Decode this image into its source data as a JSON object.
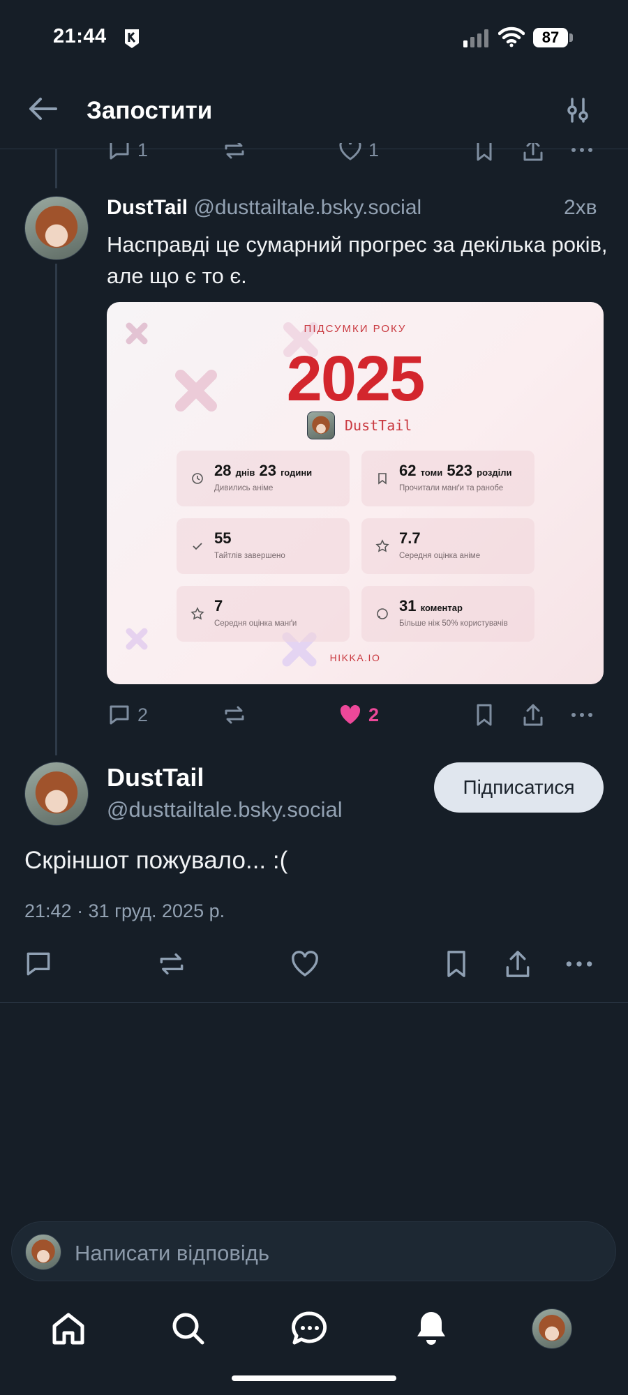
{
  "status_bar": {
    "time": "21:44",
    "battery": "87"
  },
  "header": {
    "title": "Запостити"
  },
  "parent_actions": {
    "replies": "1",
    "likes": "1"
  },
  "reply_post": {
    "display_name": "DustTail",
    "handle": "@dusttailtale.bsky.social",
    "time_ago": "2хв",
    "text": "Насправді це сумарний прогрес за декілька років, але що є то є.",
    "embed": {
      "kicker": "ПІДСУМКИ РОКУ",
      "year": "2025",
      "user": "DustTail",
      "stats": [
        {
          "icon": "history-icon",
          "value_main": "28",
          "unit_1": "днів",
          "value_2": "23",
          "unit_2": "години",
          "label": "Дивились аніме"
        },
        {
          "icon": "book-icon",
          "value_main": "62",
          "unit_1": "томи",
          "value_2": "523",
          "unit_2": "розділи",
          "label": "Прочитали манґи та ранобе"
        },
        {
          "icon": "check-icon",
          "value_main": "55",
          "unit_1": "",
          "value_2": "",
          "unit_2": "",
          "label": "Тайтлів завершено"
        },
        {
          "icon": "star-icon",
          "value_main": "7.7",
          "unit_1": "",
          "value_2": "",
          "unit_2": "",
          "label": "Середня оцінка аніме"
        },
        {
          "icon": "star-icon",
          "value_main": "7",
          "unit_1": "",
          "value_2": "",
          "unit_2": "",
          "label": "Середня оцінка манґи"
        },
        {
          "icon": "comment-icon",
          "value_main": "31",
          "unit_1": "коментар",
          "value_2": "",
          "unit_2": "",
          "label": "Більше ніж 50% користувачів"
        }
      ],
      "footer": "HIKKA.IO"
    },
    "replies": "2",
    "likes": "2",
    "like_color": "#ec4899"
  },
  "main_post": {
    "display_name": "DustTail",
    "handle": "@dusttailtale.bsky.social",
    "follow_label": "Підписатися",
    "text": "Скріншот пожувало... :(",
    "datetime": "21:42 · 31 груд. 2025 р."
  },
  "reply_bar": {
    "placeholder": "Написати відповідь"
  },
  "tabs": [
    "home-icon",
    "search-icon",
    "chat-icon",
    "bell-icon",
    "profile-avatar"
  ],
  "colors": {
    "background": "#161e27",
    "muted": "#93a2b3",
    "accent_red": "#d3262d"
  }
}
